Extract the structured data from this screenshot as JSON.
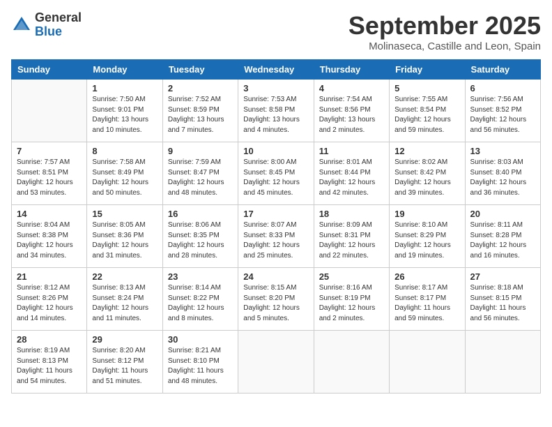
{
  "header": {
    "logo_general": "General",
    "logo_blue": "Blue",
    "month_title": "September 2025",
    "location": "Molinaseca, Castille and Leon, Spain"
  },
  "days_of_week": [
    "Sunday",
    "Monday",
    "Tuesday",
    "Wednesday",
    "Thursday",
    "Friday",
    "Saturday"
  ],
  "weeks": [
    [
      {
        "day": "",
        "content": ""
      },
      {
        "day": "1",
        "content": "Sunrise: 7:50 AM\nSunset: 9:01 PM\nDaylight: 13 hours\nand 10 minutes."
      },
      {
        "day": "2",
        "content": "Sunrise: 7:52 AM\nSunset: 8:59 PM\nDaylight: 13 hours\nand 7 minutes."
      },
      {
        "day": "3",
        "content": "Sunrise: 7:53 AM\nSunset: 8:58 PM\nDaylight: 13 hours\nand 4 minutes."
      },
      {
        "day": "4",
        "content": "Sunrise: 7:54 AM\nSunset: 8:56 PM\nDaylight: 13 hours\nand 2 minutes."
      },
      {
        "day": "5",
        "content": "Sunrise: 7:55 AM\nSunset: 8:54 PM\nDaylight: 12 hours\nand 59 minutes."
      },
      {
        "day": "6",
        "content": "Sunrise: 7:56 AM\nSunset: 8:52 PM\nDaylight: 12 hours\nand 56 minutes."
      }
    ],
    [
      {
        "day": "7",
        "content": "Sunrise: 7:57 AM\nSunset: 8:51 PM\nDaylight: 12 hours\nand 53 minutes."
      },
      {
        "day": "8",
        "content": "Sunrise: 7:58 AM\nSunset: 8:49 PM\nDaylight: 12 hours\nand 50 minutes."
      },
      {
        "day": "9",
        "content": "Sunrise: 7:59 AM\nSunset: 8:47 PM\nDaylight: 12 hours\nand 48 minutes."
      },
      {
        "day": "10",
        "content": "Sunrise: 8:00 AM\nSunset: 8:45 PM\nDaylight: 12 hours\nand 45 minutes."
      },
      {
        "day": "11",
        "content": "Sunrise: 8:01 AM\nSunset: 8:44 PM\nDaylight: 12 hours\nand 42 minutes."
      },
      {
        "day": "12",
        "content": "Sunrise: 8:02 AM\nSunset: 8:42 PM\nDaylight: 12 hours\nand 39 minutes."
      },
      {
        "day": "13",
        "content": "Sunrise: 8:03 AM\nSunset: 8:40 PM\nDaylight: 12 hours\nand 36 minutes."
      }
    ],
    [
      {
        "day": "14",
        "content": "Sunrise: 8:04 AM\nSunset: 8:38 PM\nDaylight: 12 hours\nand 34 minutes."
      },
      {
        "day": "15",
        "content": "Sunrise: 8:05 AM\nSunset: 8:36 PM\nDaylight: 12 hours\nand 31 minutes."
      },
      {
        "day": "16",
        "content": "Sunrise: 8:06 AM\nSunset: 8:35 PM\nDaylight: 12 hours\nand 28 minutes."
      },
      {
        "day": "17",
        "content": "Sunrise: 8:07 AM\nSunset: 8:33 PM\nDaylight: 12 hours\nand 25 minutes."
      },
      {
        "day": "18",
        "content": "Sunrise: 8:09 AM\nSunset: 8:31 PM\nDaylight: 12 hours\nand 22 minutes."
      },
      {
        "day": "19",
        "content": "Sunrise: 8:10 AM\nSunset: 8:29 PM\nDaylight: 12 hours\nand 19 minutes."
      },
      {
        "day": "20",
        "content": "Sunrise: 8:11 AM\nSunset: 8:28 PM\nDaylight: 12 hours\nand 16 minutes."
      }
    ],
    [
      {
        "day": "21",
        "content": "Sunrise: 8:12 AM\nSunset: 8:26 PM\nDaylight: 12 hours\nand 14 minutes."
      },
      {
        "day": "22",
        "content": "Sunrise: 8:13 AM\nSunset: 8:24 PM\nDaylight: 12 hours\nand 11 minutes."
      },
      {
        "day": "23",
        "content": "Sunrise: 8:14 AM\nSunset: 8:22 PM\nDaylight: 12 hours\nand 8 minutes."
      },
      {
        "day": "24",
        "content": "Sunrise: 8:15 AM\nSunset: 8:20 PM\nDaylight: 12 hours\nand 5 minutes."
      },
      {
        "day": "25",
        "content": "Sunrise: 8:16 AM\nSunset: 8:19 PM\nDaylight: 12 hours\nand 2 minutes."
      },
      {
        "day": "26",
        "content": "Sunrise: 8:17 AM\nSunset: 8:17 PM\nDaylight: 11 hours\nand 59 minutes."
      },
      {
        "day": "27",
        "content": "Sunrise: 8:18 AM\nSunset: 8:15 PM\nDaylight: 11 hours\nand 56 minutes."
      }
    ],
    [
      {
        "day": "28",
        "content": "Sunrise: 8:19 AM\nSunset: 8:13 PM\nDaylight: 11 hours\nand 54 minutes."
      },
      {
        "day": "29",
        "content": "Sunrise: 8:20 AM\nSunset: 8:12 PM\nDaylight: 11 hours\nand 51 minutes."
      },
      {
        "day": "30",
        "content": "Sunrise: 8:21 AM\nSunset: 8:10 PM\nDaylight: 11 hours\nand 48 minutes."
      },
      {
        "day": "",
        "content": ""
      },
      {
        "day": "",
        "content": ""
      },
      {
        "day": "",
        "content": ""
      },
      {
        "day": "",
        "content": ""
      }
    ]
  ]
}
